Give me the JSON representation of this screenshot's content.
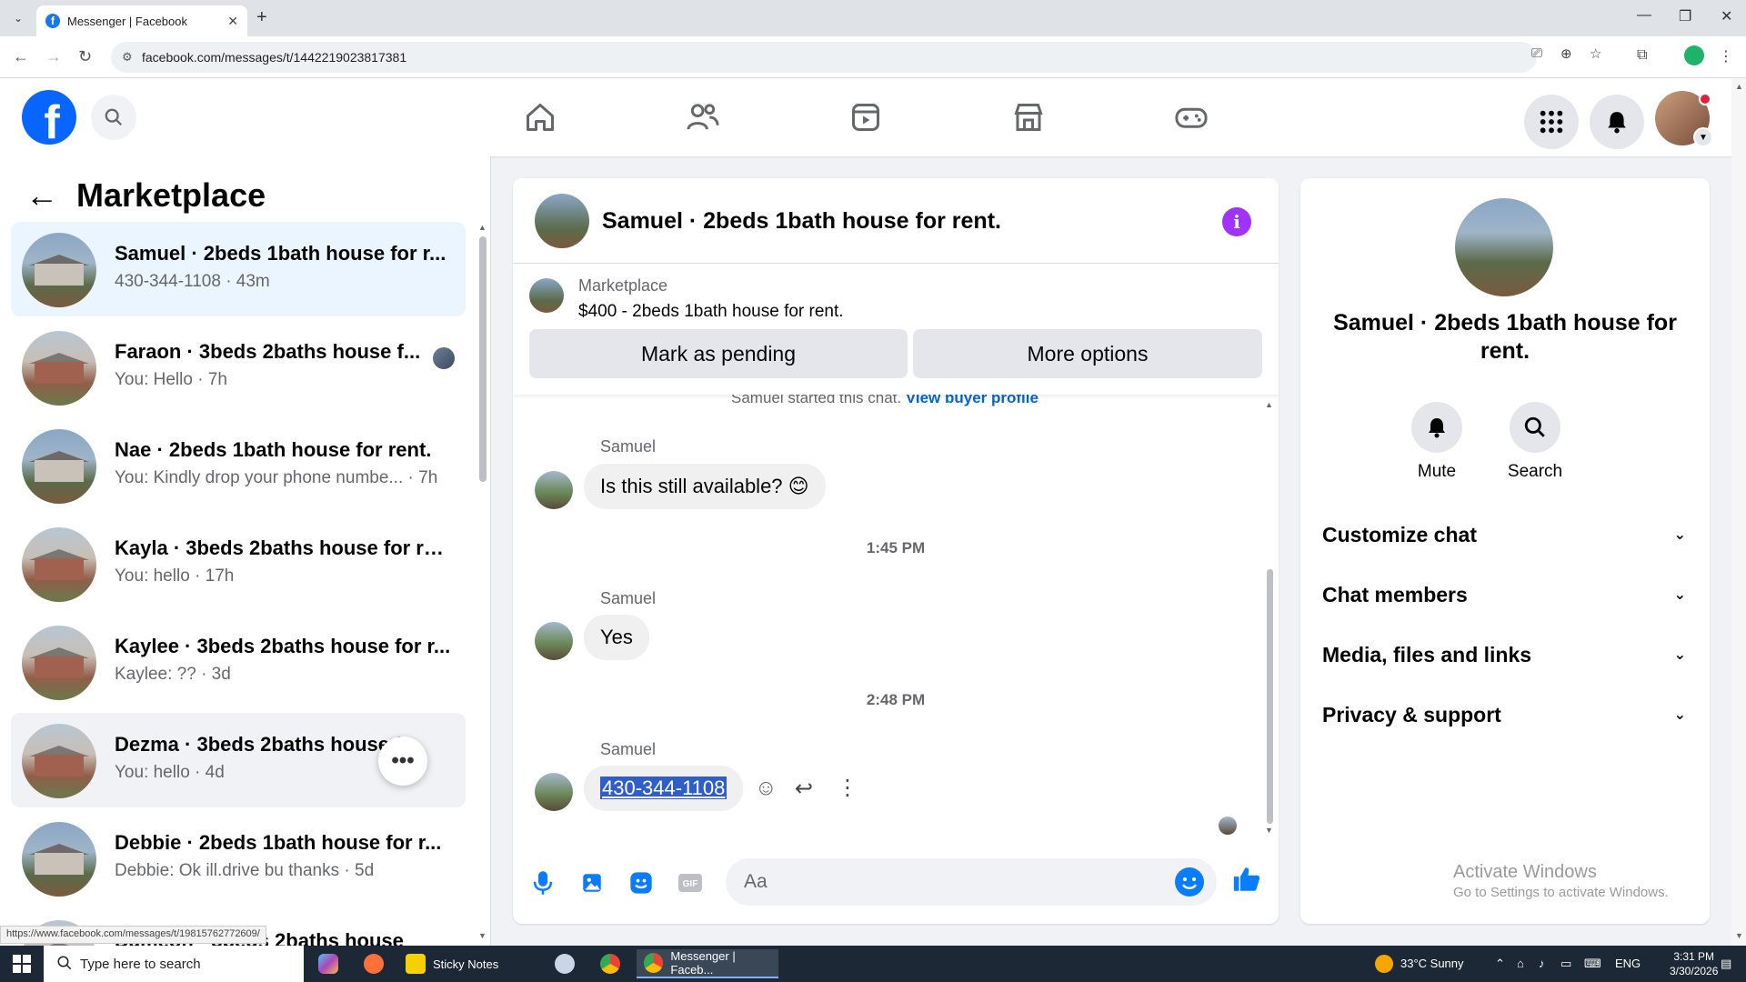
{
  "browser": {
    "tab_title": "Messenger | Facebook",
    "url": "facebook.com/messages/t/1442219023817381",
    "status_url": "https://www.facebook.com/messages/t/19815762772609/"
  },
  "left": {
    "back_label": "←",
    "title": "Marketplace",
    "conversations": [
      {
        "name": "Samuel · 2beds 1bath house for r...",
        "sub": "430-344-1108 · 43m"
      },
      {
        "name": "Faraon · 3beds 2baths house f...",
        "sub": "You: Hello · 7h"
      },
      {
        "name": "Nae · 2beds 1bath house for rent.",
        "sub": "You: Kindly drop your phone numbe... · 7h"
      },
      {
        "name": "Kayla · 3beds 2baths house for re...",
        "sub": "You: hello · 17h"
      },
      {
        "name": "Kaylee · 3beds 2baths house for r...",
        "sub": "Kaylee: ?? · 3d"
      },
      {
        "name": "Dezma · 3beds 2baths house f...",
        "sub": "You: hello · 4d"
      },
      {
        "name": "Debbie · 2beds 1bath house for r...",
        "sub": "Debbie: Ok ill.drive bu thanks · 5d"
      },
      {
        "name": "Dameon · 3beds 2baths house",
        "sub": ""
      }
    ],
    "more_label": "•••"
  },
  "chat": {
    "title": "Samuel · 2beds 1bath house for rent.",
    "info_glyph": "i",
    "marketplace_label": "Marketplace",
    "listing": "$400 - 2beds 1bath house for rent.",
    "mark_pending": "Mark as pending",
    "more_options": "More options",
    "started_text": "Samuel started this chat.",
    "view_buyer": "View buyer profile",
    "messages": [
      {
        "sender": "Samuel",
        "text": "Is this still available? 😊"
      },
      {
        "sender": "Samuel",
        "text": "Yes"
      },
      {
        "sender": "Samuel",
        "text": "430-344-1108"
      }
    ],
    "timestamps": [
      "1:45 PM",
      "2:48 PM"
    ],
    "composer_placeholder": "Aa"
  },
  "right": {
    "name": "Samuel · 2beds 1bath house for rent.",
    "mute": "Mute",
    "search": "Search",
    "sections": [
      "Customize chat",
      "Chat members",
      "Media, files and links",
      "Privacy & support"
    ],
    "activate_title": "Activate Windows",
    "activate_sub": "Go to Settings to activate Windows."
  },
  "taskbar": {
    "search_placeholder": "Type here to search",
    "apps": [
      "Sticky Notes",
      "Messenger | Faceb..."
    ],
    "weather": "33°C  Sunny",
    "lang": "ENG",
    "time": "3:31 PM",
    "date": "3/30/2026"
  },
  "colors": {
    "fb_blue": "#0866ff",
    "messenger_blue": "#0a7cff",
    "info_purple": "#a033ff"
  }
}
